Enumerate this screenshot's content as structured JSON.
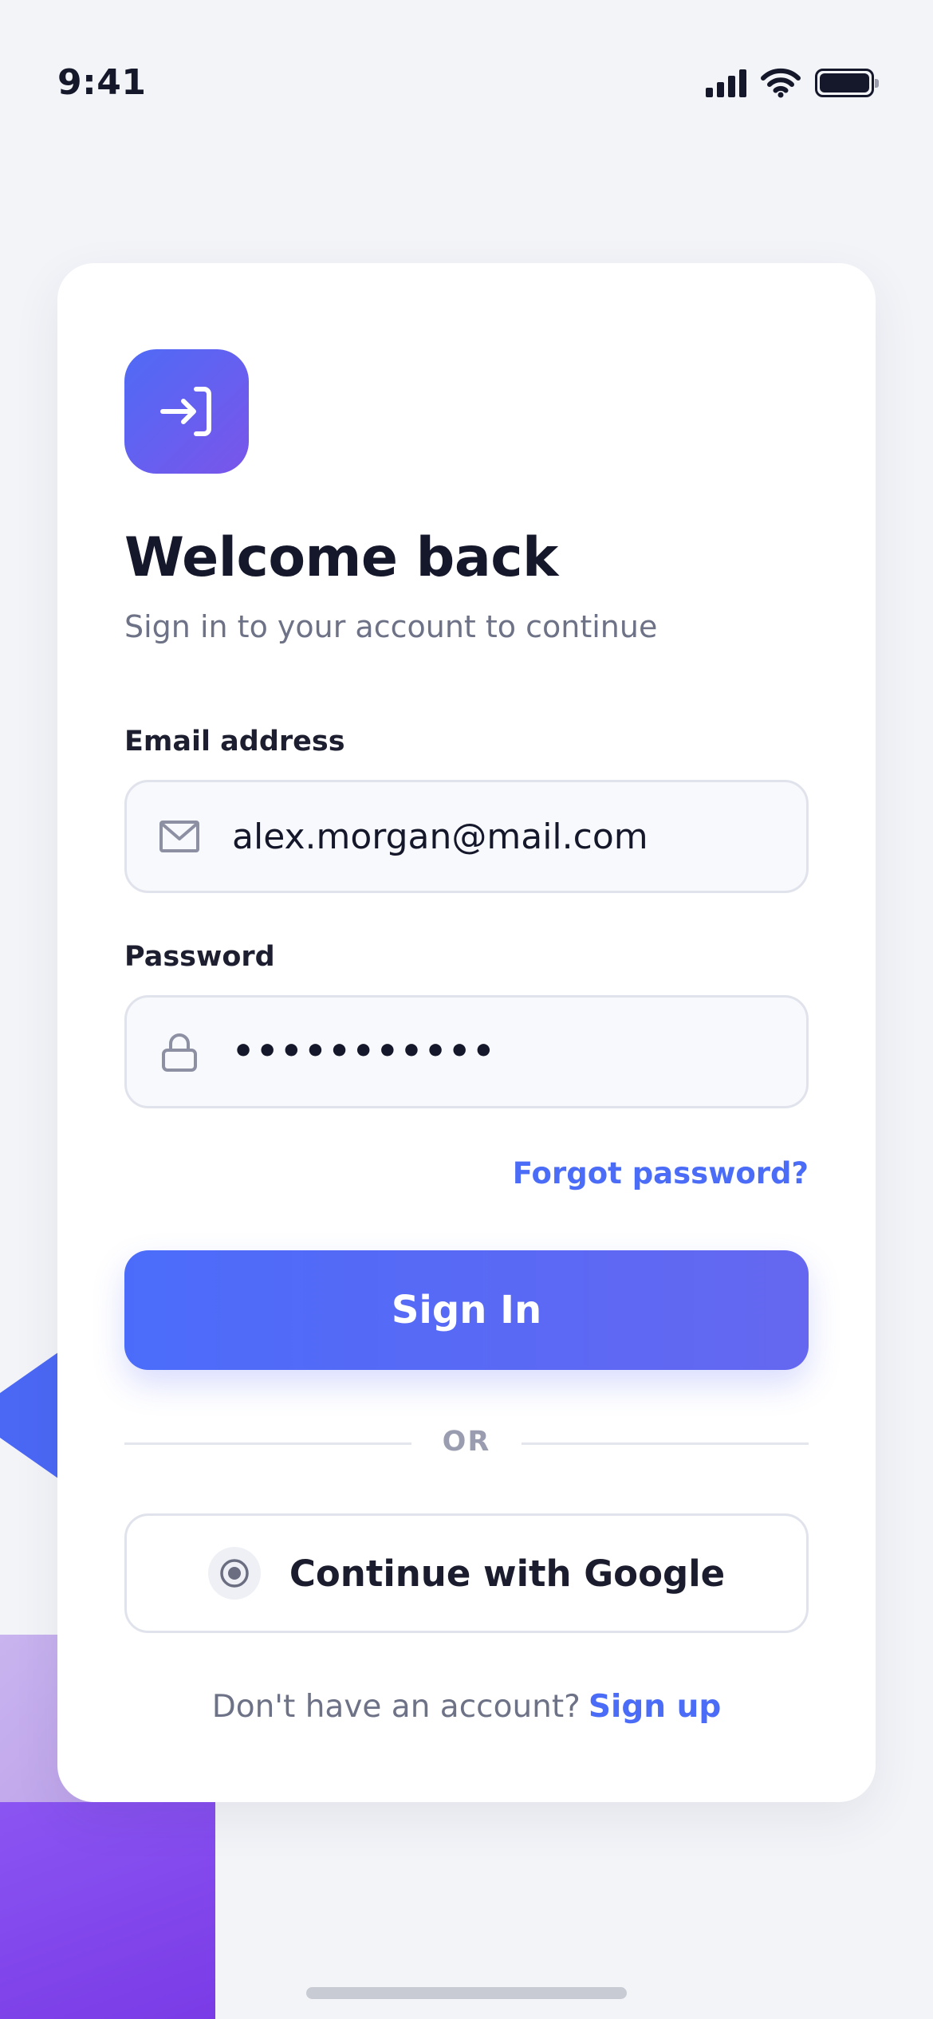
{
  "status_bar": {
    "time": "9:41",
    "icons": [
      "signal-icon",
      "wifi-icon",
      "battery-icon"
    ]
  },
  "login_card": {
    "logo_icon": "sign-in-arrow-icon",
    "title": "Welcome back",
    "subtitle": "Sign in to your account to continue",
    "email": {
      "label": "Email address",
      "value": "alex.morgan@mail.com",
      "icon": "mail-icon"
    },
    "password": {
      "label": "Password",
      "value": "•••••••••••",
      "icon": "lock-icon"
    },
    "forgot_password": "Forgot password?",
    "sign_in_button": "Sign In",
    "divider": "OR",
    "google_button": {
      "label": "Continue with Google",
      "icon": "radio-dot-icon"
    },
    "signup": {
      "prompt": "Don't have an account?",
      "link": "Sign up"
    }
  },
  "colors": {
    "accent": "#4b6cf6",
    "accent_gradient_end": "#6567f0",
    "logo_gradient_start": "#4f6bf6",
    "logo_gradient_end": "#7a55ea",
    "background": "#f3f4f8",
    "title_text": "#15172a",
    "muted_text": "#6e7287"
  }
}
